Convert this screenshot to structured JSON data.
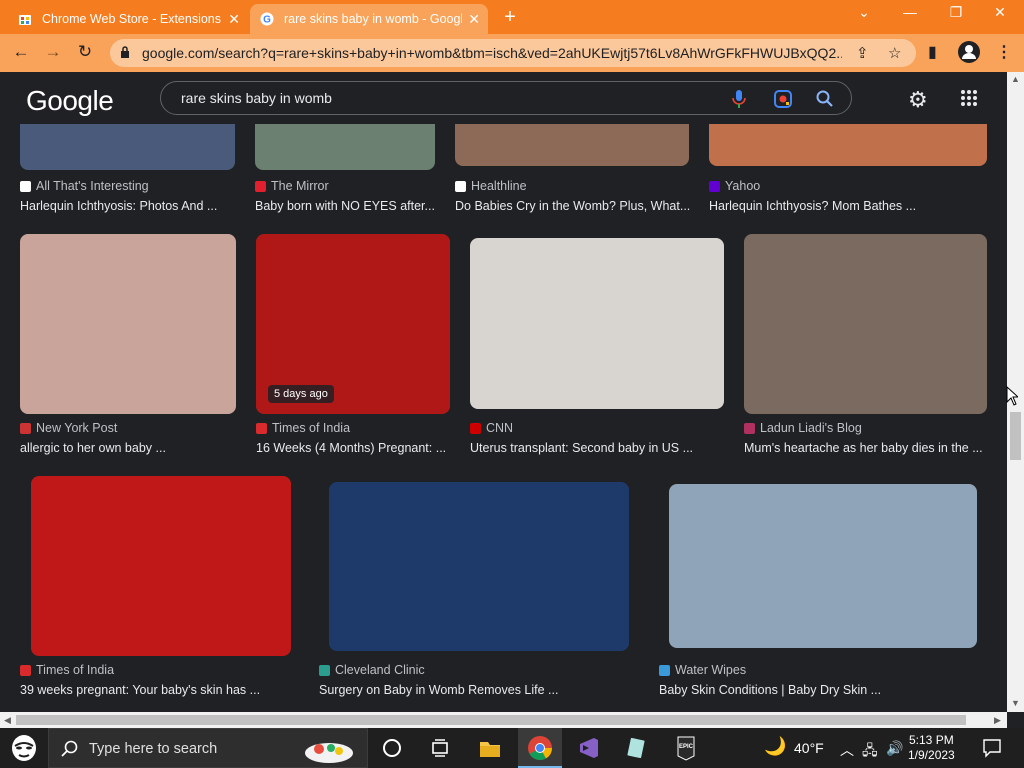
{
  "browser": {
    "tabs": [
      {
        "title": "Chrome Web Store - Extensions",
        "active": false
      },
      {
        "title": "rare skins baby in womb - Google",
        "active": true
      }
    ],
    "url": "google.com/search?q=rare+skins+baby+in+womb&tbm=isch&ved=2ahUKEwjtj57t6Lv8AhWrGFkFHWUJBxQQ2..."
  },
  "google": {
    "logo": "Google",
    "query": "rare skins baby in womb"
  },
  "rows": [
    [
      {
        "source": "All That's Interesting",
        "title": "Harlequin Ichthyosis: Photos And ...",
        "color": "#4a5a7a"
      },
      {
        "source": "The Mirror",
        "title": "Baby born with NO EYES after...",
        "color": "#6b8070",
        "icon_color": "#e0202f"
      },
      {
        "source": "Healthline",
        "title": "Do Babies Cry in the Womb? Plus, What...",
        "color": "#8d6a58"
      },
      {
        "source": "Yahoo",
        "title": "Harlequin Ichthyosis? Mom Bathes ...",
        "color": "#c0704a",
        "icon_color": "#6001d2"
      }
    ],
    [
      {
        "source": "New York Post",
        "title": "allergic to her own baby ...",
        "color": "#c9a49a",
        "icon_color": "#cc3333"
      },
      {
        "source": "Times of India",
        "title": "16 Weeks (4 Months) Pregnant: ...",
        "color": "#b01818",
        "icon_color": "#d92b2b",
        "badge": "5 days ago"
      },
      {
        "source": "CNN",
        "title": "Uterus transplant: Second baby in US ...",
        "color": "#d8d4cf",
        "icon_color": "#cc0000"
      },
      {
        "source": "Ladun Liadi's Blog",
        "title": "Mum's heartache as her baby dies in the ...",
        "color": "#7a6a60",
        "icon_color": "#b03060"
      }
    ],
    [
      {
        "source": "Times of India",
        "title": "39 weeks pregnant: Your baby's skin has ...",
        "color": "#c01818",
        "icon_color": "#d92b2b"
      },
      {
        "source": "Cleveland Clinic",
        "title": "Surgery on Baby in Womb Removes Life ...",
        "color": "#1e3a6a",
        "icon_color": "#2a9d8f"
      },
      {
        "source": "Water Wipes",
        "title": "Baby Skin Conditions | Baby Dry Skin ...",
        "color": "#8fa4b8",
        "icon_color": "#3a9ad9"
      }
    ]
  ],
  "taskbar": {
    "search_placeholder": "Type here to search",
    "weather": "40°F",
    "time": "5:13 PM",
    "date": "1/9/2023"
  }
}
